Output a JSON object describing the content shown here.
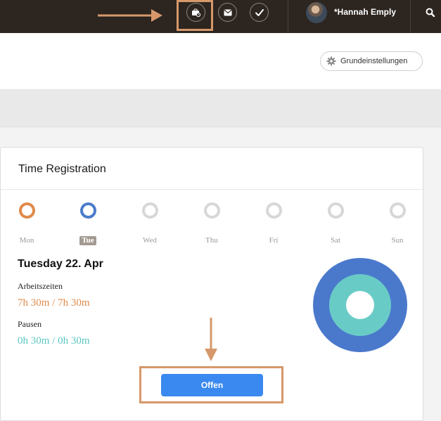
{
  "colors": {
    "topbar": "#2c2520",
    "annotation": "#d6986a",
    "orange": "#e08a4a",
    "teal": "#5cc6c3",
    "blue": "#4c7ccb",
    "button": "#3a89f0",
    "ring_inactive": "#d7d7d7",
    "chart_outer": "#4a79cc",
    "chart_inner": "#69cbc6"
  },
  "topbar": {
    "icons": [
      "briefcase-clock-icon",
      "envelope-icon",
      "checkmark-icon",
      "search-icon"
    ],
    "user_name": "*Hannah Emply"
  },
  "header": {
    "settings_label": "Grundeinstellungen"
  },
  "card": {
    "title": "Time Registration",
    "days": [
      {
        "label": "Mon",
        "state": "done",
        "ring_color": "#e08a4a"
      },
      {
        "label": "Tue",
        "state": "selected",
        "ring_color": "#4c7ccb"
      },
      {
        "label": "Wed",
        "state": "future",
        "ring_color": "#d7d7d7"
      },
      {
        "label": "Thu",
        "state": "future",
        "ring_color": "#d7d7d7"
      },
      {
        "label": "Fri",
        "state": "future",
        "ring_color": "#d7d7d7"
      },
      {
        "label": "Sat",
        "state": "future",
        "ring_color": "#d7d7d7"
      },
      {
        "label": "Sun",
        "state": "future",
        "ring_color": "#d7d7d7"
      }
    ],
    "date_heading": "Tuesday 22. Apr",
    "work_label": "Arbeitszeiten",
    "work_value": "7h 30m / 7h 30m",
    "break_label": "Pausen",
    "break_value": "0h 30m / 0h 30m",
    "submit_label": "Offen"
  }
}
